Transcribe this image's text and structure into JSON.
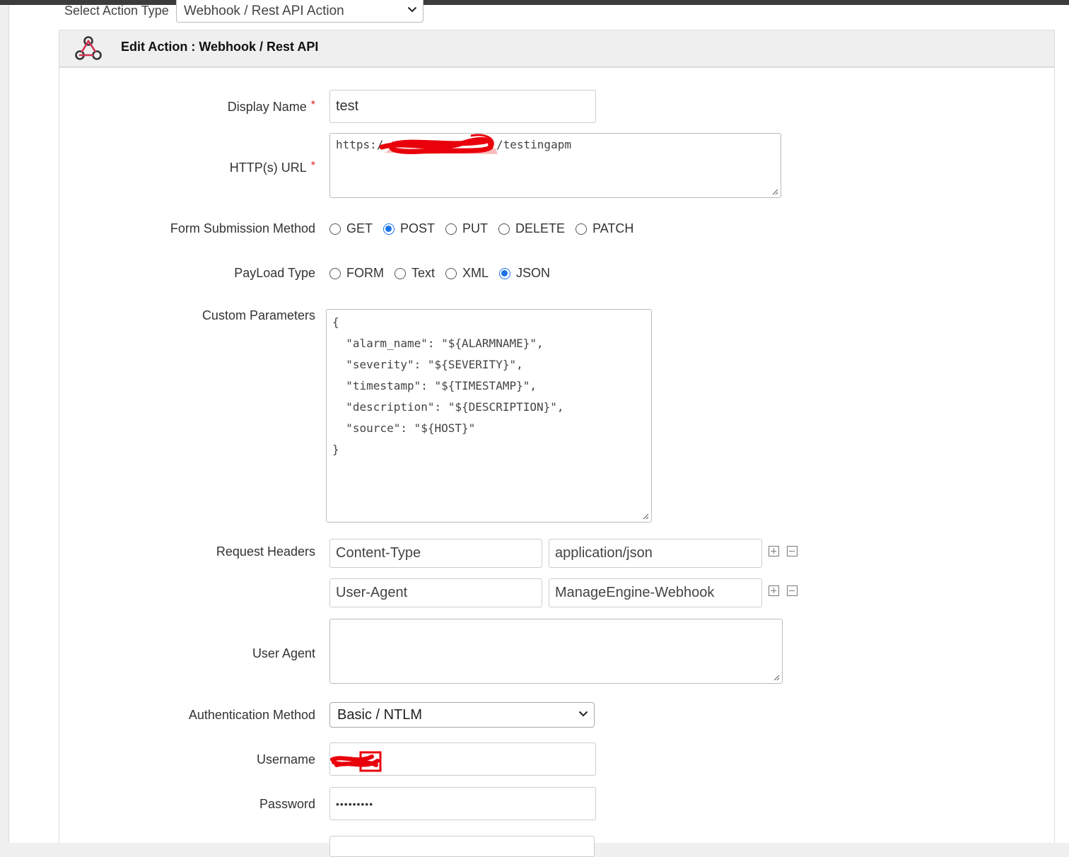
{
  "action_type": {
    "label": "Select Action Type",
    "selected": "Webhook / Rest API Action"
  },
  "panel": {
    "title": "Edit Action : Webhook / Rest API"
  },
  "form": {
    "display_name": {
      "label": "Display Name",
      "required": "*",
      "value": "test"
    },
    "http_url": {
      "label": "HTTP(s) URL",
      "required": "*",
      "prefix": "https:/",
      "suffix": "/testingapm"
    },
    "method": {
      "label": "Form Submission Method",
      "options": [
        "GET",
        "POST",
        "PUT",
        "DELETE",
        "PATCH"
      ],
      "selected": "POST"
    },
    "payload": {
      "label": "PayLoad Type",
      "options": [
        "FORM",
        "Text",
        "XML",
        "JSON"
      ],
      "selected": "JSON"
    },
    "custom_params": {
      "label": "Custom Parameters",
      "lines": [
        "{",
        "  \"alarm_name\": \"${ALARMNAME}\",",
        "  \"severity\": \"${SEVERITY}\",",
        "  \"timestamp\": \"${TIMESTAMP}\",",
        "  \"description\": \"${DESCRIPTION}\",",
        "  \"source\": \"${HOST}\"",
        "}"
      ]
    },
    "request_headers": {
      "label": "Request Headers",
      "rows": [
        {
          "name": "Content-Type",
          "value": "application/json"
        },
        {
          "name": "User-Agent",
          "value": "ManageEngine-Webhook"
        }
      ]
    },
    "user_agent": {
      "label": "User Agent",
      "value": ""
    },
    "auth_method": {
      "label": "Authentication Method",
      "selected": "Basic / NTLM"
    },
    "username": {
      "label": "Username",
      "value": ""
    },
    "password": {
      "label": "Password",
      "value": "•••••••••"
    }
  },
  "colors": {
    "accent": "#1a73e8",
    "required": "#e02020",
    "redaction": "#e8000b",
    "webhook_icon": "#333333"
  },
  "icons": [
    "webhook-icon",
    "chevron-down-icon",
    "plus-box-icon",
    "minus-box-icon",
    "resize-grip-icon"
  ]
}
